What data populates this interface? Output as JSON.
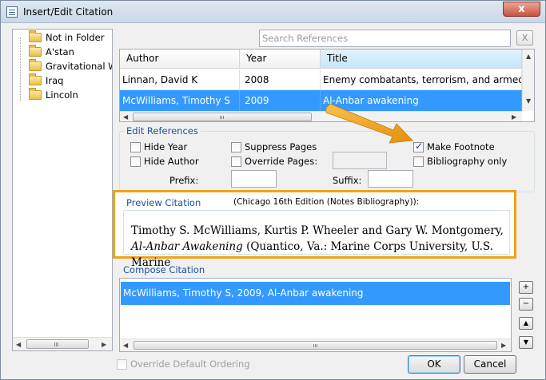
{
  "window": {
    "title": "Insert/Edit Citation",
    "close_glyph": "x"
  },
  "tree": {
    "items": [
      {
        "label": "Not in Folder"
      },
      {
        "label": "A'stan"
      },
      {
        "label": "Gravitational Waves"
      },
      {
        "label": "Iraq"
      },
      {
        "label": "Lincoln"
      }
    ]
  },
  "search": {
    "placeholder": "Search References",
    "clear_label": "X"
  },
  "references": {
    "columns": [
      "Author",
      "Year",
      "Title"
    ],
    "rows": [
      {
        "author": "Linnan, David K",
        "year": "2008",
        "title": "Enemy combatants, terrorism, and armed conflict law"
      },
      {
        "author": "McWilliams, Timothy S",
        "year": "2009",
        "title": "Al-Anbar awakening",
        "selected": true
      }
    ]
  },
  "edit": {
    "label": "Edit References",
    "hide_year": "Hide Year",
    "hide_author": "Hide Author",
    "suppress_pages": "Suppress Pages",
    "override_pages": "Override Pages:",
    "make_footnote": "Make Footnote",
    "bibliography_only": "Bibliography only",
    "prefix": "Prefix:",
    "suffix": "Suffix:",
    "make_footnote_checked": true
  },
  "preview": {
    "label": "Preview Citation",
    "style": "(Chicago 16th Edition (Notes  Bibliography)):",
    "text_before": "Timothy S. McWilliams, Kurtis P. Wheeler and Gary W. Montgomery, ",
    "text_italic": "Al-Anbar Awakening",
    "text_after": " (Quantico, Va.: Marine Corps University, U.S. Marine"
  },
  "compose": {
    "label": "Compose Citation",
    "items": [
      "McWilliams, Timothy S, 2009, Al-Anbar awakening"
    ]
  },
  "side_buttons": {
    "add": "+",
    "remove": "−",
    "up": "▲",
    "down": "▼"
  },
  "footer": {
    "override_ordering": "Override Default Ordering",
    "ok": "OK",
    "cancel": "Cancel"
  },
  "colors": {
    "selection": "#3399ff",
    "highlight": "#f0a21a",
    "group_label": "#1a4f9c"
  },
  "icons": [
    "folder-icon",
    "checkbox-icon",
    "arrow-icon"
  ]
}
